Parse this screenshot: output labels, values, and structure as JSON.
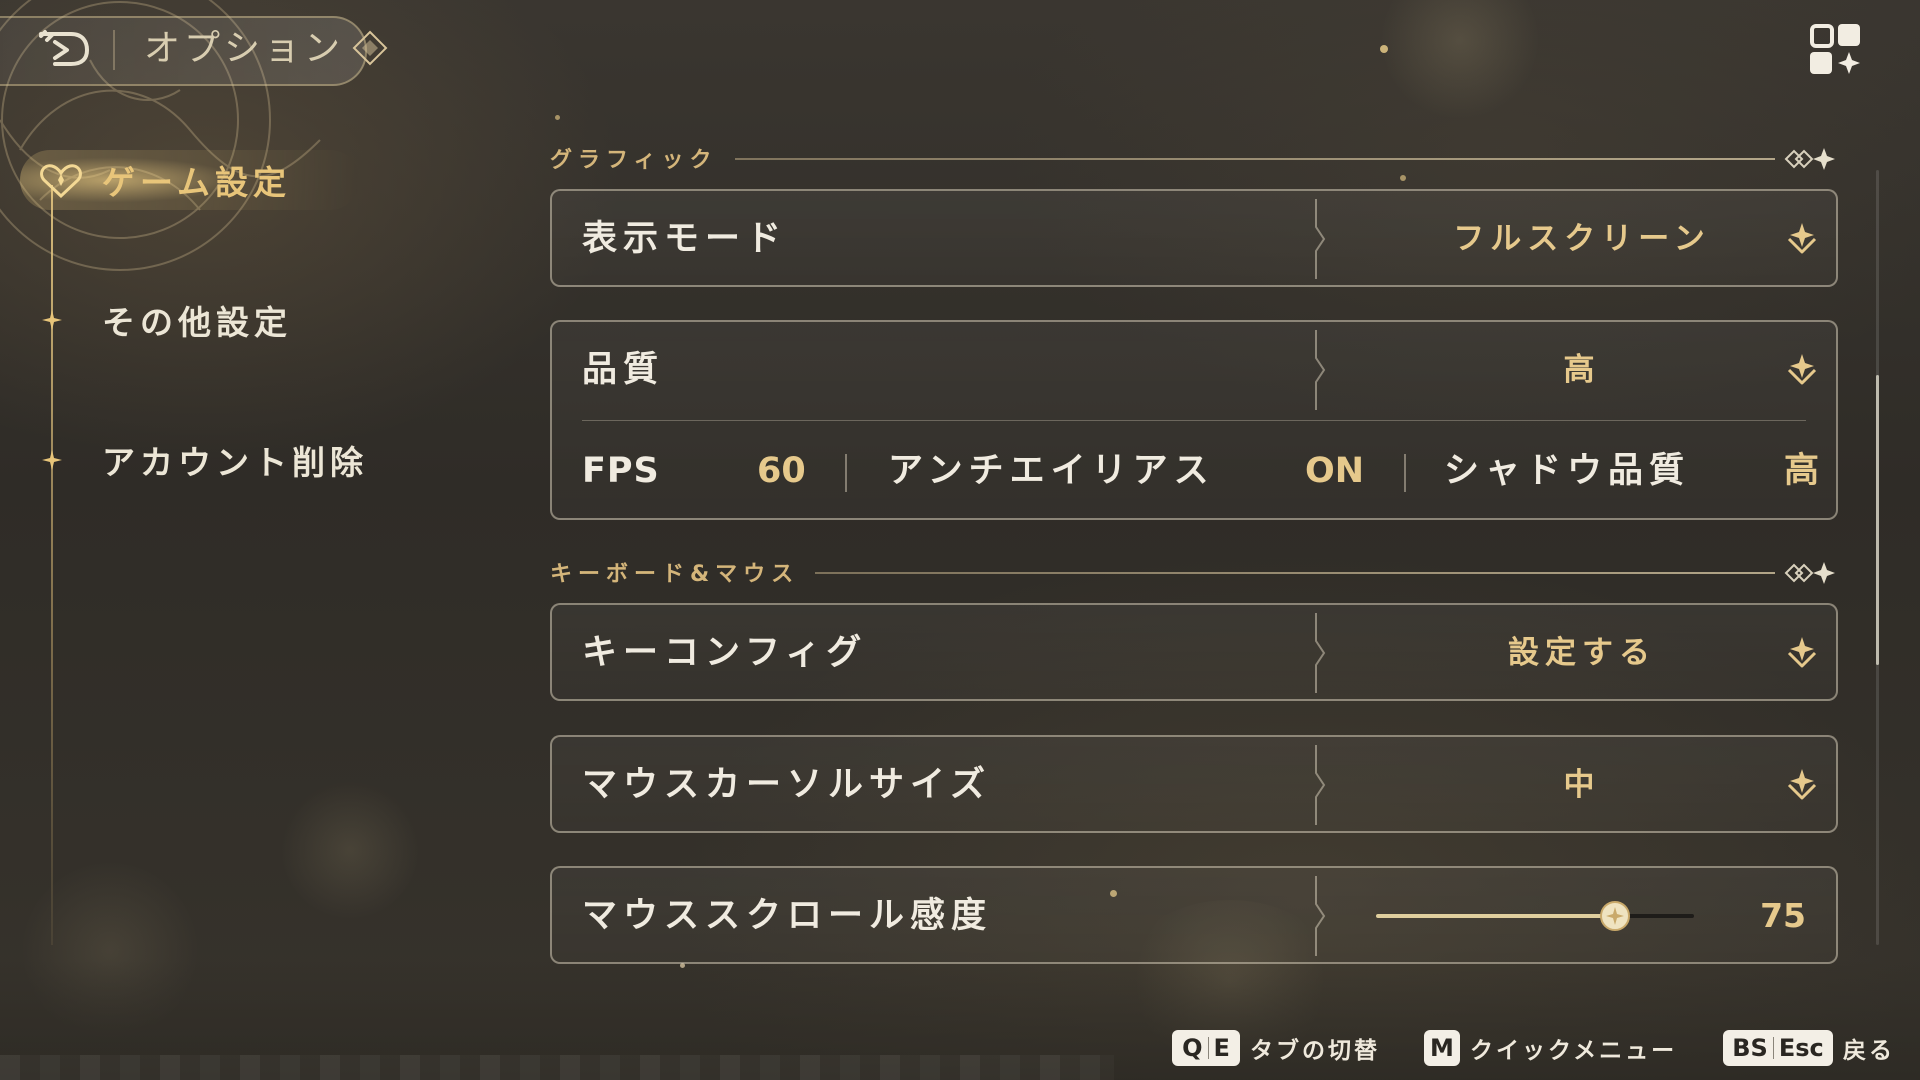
{
  "header": {
    "title": "オプション",
    "back_icon": "back-arrow-icon",
    "menu_icon": "quick-menu-grid-icon"
  },
  "sidebar": {
    "items": [
      {
        "label": "ゲーム設定",
        "active": true
      },
      {
        "label": "その他設定",
        "active": false
      },
      {
        "label": "アカウント削除",
        "active": false
      }
    ]
  },
  "sections": {
    "graphics": {
      "title": "グラフィック",
      "display_mode": {
        "label": "表示モード",
        "value": "フルスクリーン"
      },
      "quality": {
        "label": "品質",
        "value": "高"
      },
      "sub_settings": {
        "fps_label": "FPS",
        "fps_value": "60",
        "aa_label": "アンチエイリアス",
        "aa_value": "ON",
        "shadow_label": "シャドウ品質",
        "shadow_value": "高"
      }
    },
    "keyboard_mouse": {
      "title": "キーボード&マウス",
      "key_config": {
        "label": "キーコンフィグ",
        "value": "設定する"
      },
      "cursor_size": {
        "label": "マウスカーソルサイズ",
        "value": "中"
      },
      "scroll_sensitivity": {
        "label": "マウススクロール感度",
        "value": "75",
        "min": 0,
        "max": 100
      }
    }
  },
  "footer": {
    "hints": [
      {
        "keys": [
          "Q",
          "E"
        ],
        "label": "タブの切替"
      },
      {
        "keys": [
          "M"
        ],
        "label": "クイックメニュー"
      },
      {
        "keys": [
          "BS",
          "Esc"
        ],
        "label": "戻る"
      }
    ]
  },
  "colors": {
    "accent_gold": "#e6c98c",
    "text_primary": "#f0ebe0",
    "background": "#2f2c27"
  }
}
